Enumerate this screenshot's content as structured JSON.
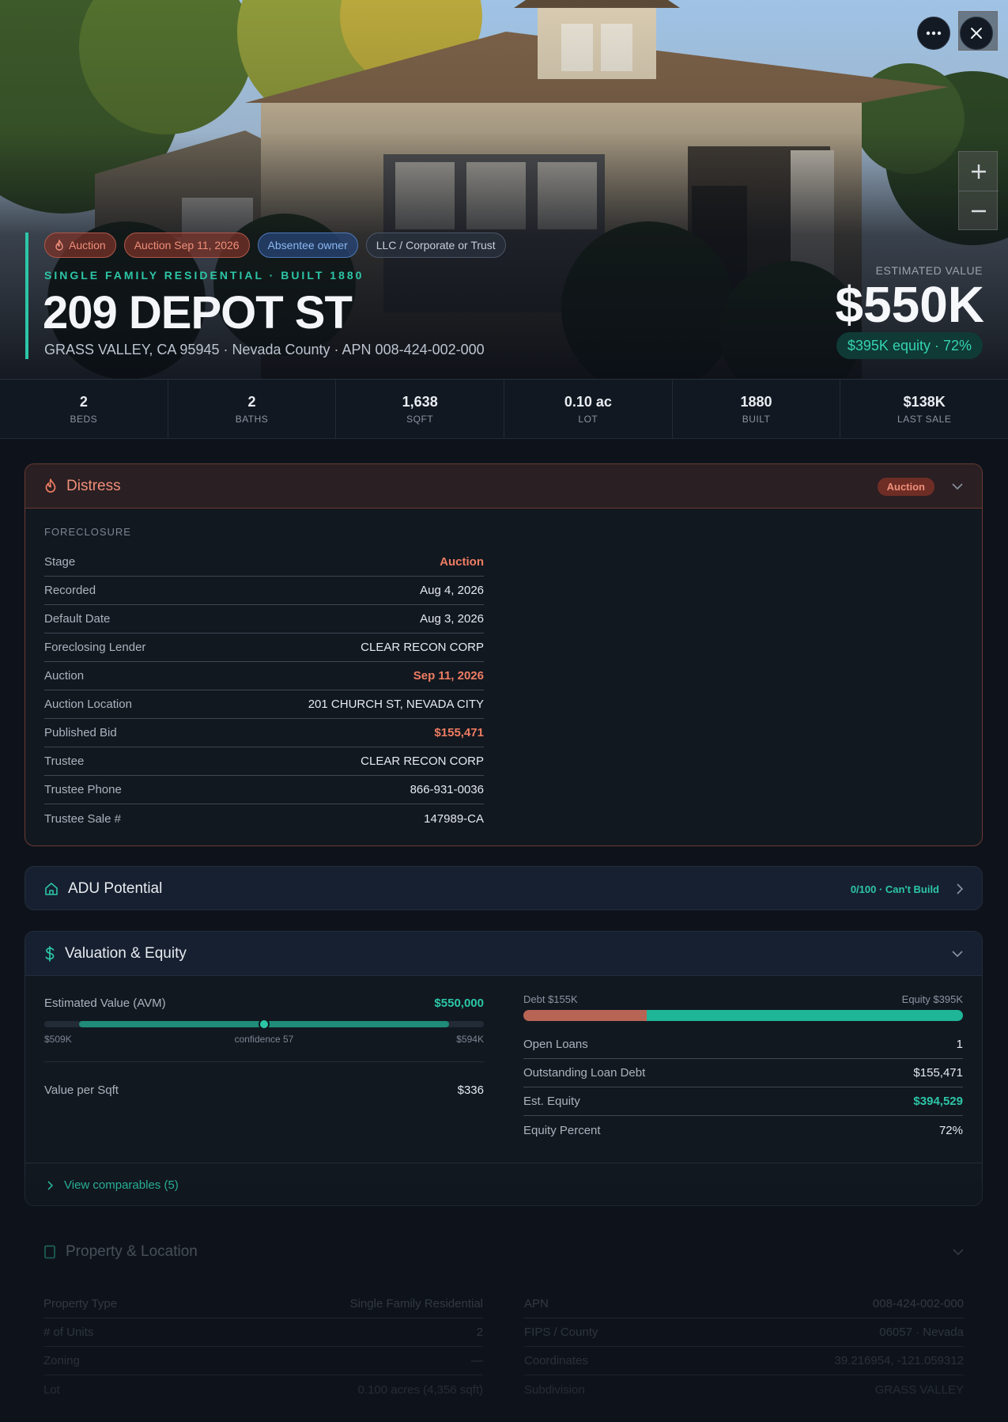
{
  "hero": {
    "chips": [
      {
        "label": "Auction",
        "kind": "auction",
        "icon": "flame-icon"
      },
      {
        "label": "Auction Sep 11, 2026",
        "kind": "auction"
      },
      {
        "label": "Absentee owner",
        "kind": "absentee"
      },
      {
        "label": "LLC / Corporate or Trust",
        "kind": "llc"
      }
    ],
    "subline": "SINGLE FAMILY RESIDENTIAL · BUILT 1880",
    "address": "209 DEPOT ST",
    "location": "GRASS VALLEY, CA 95945 · Nevada County · APN 008-424-002-000",
    "estimated_label": "ESTIMATED VALUE",
    "estimated_value": "$550K",
    "equity_pill": "$395K equity · 72%"
  },
  "stats": [
    {
      "value": "2",
      "label": "BEDS"
    },
    {
      "value": "2",
      "label": "BATHS"
    },
    {
      "value": "1,638",
      "label": "SQFT"
    },
    {
      "value": "0.10 ac",
      "label": "LOT"
    },
    {
      "value": "1880",
      "label": "BUILT"
    },
    {
      "value": "$138K",
      "label": "LAST SALE"
    }
  ],
  "distress": {
    "title": "Distress",
    "badge": "Auction",
    "section_label": "FORECLOSURE",
    "rows": [
      {
        "k": "Stage",
        "v": "Auction",
        "tone": "red"
      },
      {
        "k": "Recorded",
        "v": "Aug 4, 2026"
      },
      {
        "k": "Default Date",
        "v": "Aug 3, 2026"
      },
      {
        "k": "Foreclosing Lender",
        "v": "CLEAR RECON CORP"
      },
      {
        "k": "Auction",
        "v": "Sep 11, 2026",
        "tone": "red"
      },
      {
        "k": "Auction Location",
        "v": "201 CHURCH ST, NEVADA CITY"
      },
      {
        "k": "Published Bid",
        "v": "$155,471",
        "tone": "red"
      },
      {
        "k": "Trustee",
        "v": "CLEAR RECON CORP"
      },
      {
        "k": "Trustee Phone",
        "v": "866-931-0036"
      },
      {
        "k": "Trustee Sale #",
        "v": "147989-CA"
      }
    ]
  },
  "adu": {
    "title": "ADU Potential",
    "score": "0/100 · Can't Build"
  },
  "valuation": {
    "title": "Valuation & Equity",
    "avm_label": "Estimated Value (AVM)",
    "avm_value": "$550,000",
    "range_low": "$509K",
    "range_high": "$594K",
    "confidence": "confidence 57",
    "range_fill_start_pct": 8,
    "range_fill_end_pct": 92,
    "point_pct": 50,
    "vps_label": "Value per Sqft",
    "vps_value": "$336",
    "debt_label": "Debt $155K",
    "equity_label": "Equity $395K",
    "debt_pct": 28,
    "rows": [
      {
        "k": "Open Loans",
        "v": "1"
      },
      {
        "k": "Outstanding Loan Debt",
        "v": "$155,471"
      },
      {
        "k": "Est. Equity",
        "v": "$394,529",
        "tone": "green"
      },
      {
        "k": "Equity Percent",
        "v": "72%"
      }
    ],
    "comps_label": "View comparables (5)"
  },
  "property": {
    "title": "Property & Location",
    "left": [
      {
        "k": "Property Type",
        "v": "Single Family Residential"
      },
      {
        "k": "# of Units",
        "v": "2"
      },
      {
        "k": "Zoning",
        "v": "—"
      },
      {
        "k": "Lot",
        "v": "0.100 acres (4,356 sqft)"
      }
    ],
    "right": [
      {
        "k": "APN",
        "v": "008-424-002-000"
      },
      {
        "k": "FIPS / County",
        "v": "06057 · Nevada"
      },
      {
        "k": "Coordinates",
        "v": "39.216954, -121.059312"
      },
      {
        "k": "Subdivision",
        "v": "GRASS VALLEY"
      }
    ]
  },
  "colors": {
    "accent": "#2cc6a7",
    "danger": "#ee7d62",
    "background": "#0e131b"
  }
}
